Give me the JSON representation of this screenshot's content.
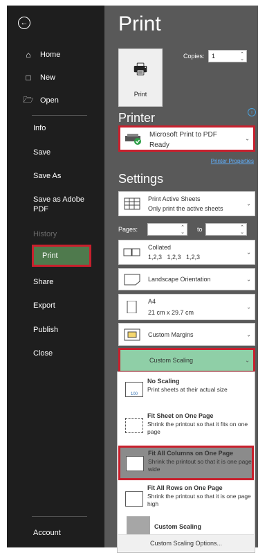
{
  "sidebar": {
    "nav": [
      {
        "label": "Home",
        "icon": "home-icon"
      },
      {
        "label": "New",
        "icon": "new-file-icon"
      },
      {
        "label": "Open",
        "icon": "open-folder-icon"
      }
    ],
    "items": [
      "Info",
      "Save",
      "Save As",
      "Save as Adobe\nPDF",
      "History",
      "Print",
      "Share",
      "Export",
      "Publish",
      "Close"
    ],
    "account": "Account"
  },
  "main": {
    "title": "Print",
    "print_button": "Print",
    "copies_label": "Copies:",
    "copies_value": "1",
    "printer_heading": "Printer",
    "printer": {
      "name": "Microsoft Print to PDF",
      "status": "Ready"
    },
    "printer_properties": "Printer Properties",
    "settings_heading": "Settings",
    "print_what": {
      "title": "Print Active Sheets",
      "sub": "Only print the active sheets"
    },
    "pages_label": "Pages:",
    "to_label": "to",
    "collation": {
      "title": "Collated",
      "sub": "1,2,3   1,2,3   1,2,3"
    },
    "orientation": "Landscape Orientation",
    "paper": {
      "title": "A4",
      "sub": "21 cm x 29.7 cm"
    },
    "margins": "Custom Margins",
    "scaling_selected": "Custom Scaling",
    "scaling_options": [
      {
        "title": "No Scaling",
        "desc": "Print sheets at their actual size",
        "icon": "no-scaling-icon"
      },
      {
        "title": "Fit Sheet on One Page",
        "desc": "Shrink the printout so that it fits on one page",
        "icon": "fit-sheet-icon"
      },
      {
        "title": "Fit All Columns on One Page",
        "desc": "Shrink the printout so that it is one page wide",
        "icon": "fit-columns-icon"
      },
      {
        "title": "Fit All Rows on One Page",
        "desc": "Shrink the printout so that it is one page high",
        "icon": "fit-rows-icon"
      },
      {
        "title": "Custom Scaling",
        "desc": "",
        "icon": "custom-scaling-icon"
      }
    ],
    "custom_scaling_options": "Custom Scaling Options..."
  }
}
